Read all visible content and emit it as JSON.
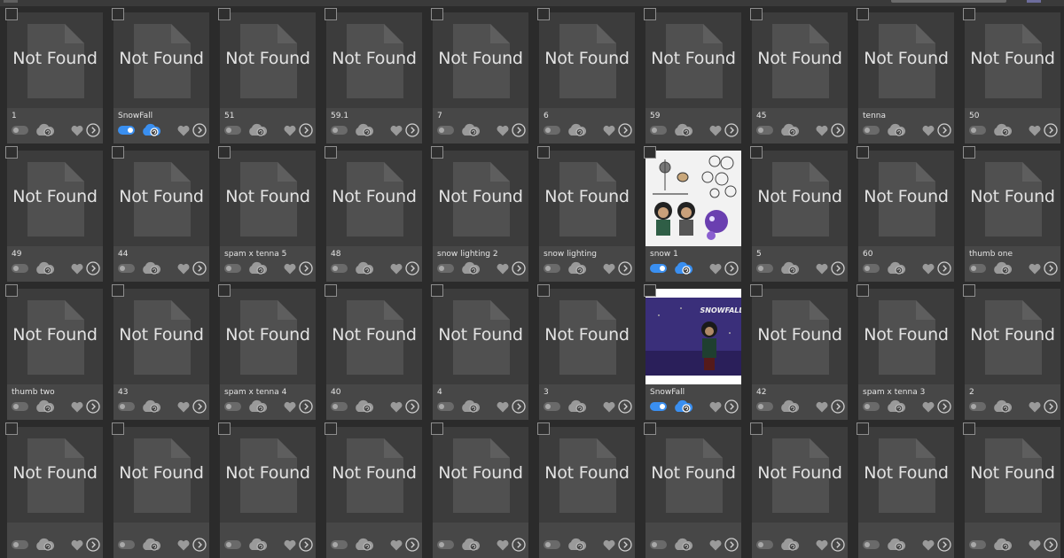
{
  "placeholder_text": "Not Found",
  "colors": {
    "toggle_on": "#3a8ff0",
    "cloud_on": "#3a8ff0",
    "icon_gray": "#9a9a9a"
  },
  "rows": [
    [
      {
        "name": "1",
        "status": "off",
        "thumb": "missing"
      },
      {
        "name": "SnowFall",
        "status": "on",
        "thumb": "missing"
      },
      {
        "name": "51",
        "status": "off",
        "thumb": "missing"
      },
      {
        "name": "59.1",
        "status": "off",
        "thumb": "missing"
      },
      {
        "name": "7",
        "status": "off",
        "thumb": "missing"
      },
      {
        "name": "6",
        "status": "off",
        "thumb": "missing"
      },
      {
        "name": "59",
        "status": "off",
        "thumb": "missing"
      },
      {
        "name": "45",
        "status": "off",
        "thumb": "missing"
      },
      {
        "name": "tenna",
        "status": "off",
        "thumb": "missing"
      },
      {
        "name": "50",
        "status": "off",
        "thumb": "missing"
      }
    ],
    [
      {
        "name": "49",
        "status": "off",
        "thumb": "missing"
      },
      {
        "name": "44",
        "status": "off",
        "thumb": "missing"
      },
      {
        "name": "spam x tenna 5",
        "status": "off",
        "thumb": "missing"
      },
      {
        "name": "48",
        "status": "off",
        "thumb": "missing"
      },
      {
        "name": "snow lighting 2",
        "status": "off",
        "thumb": "missing"
      },
      {
        "name": "snow lighting",
        "status": "off",
        "thumb": "missing"
      },
      {
        "name": "snow 1",
        "status": "on",
        "thumb": "character-sheet"
      },
      {
        "name": "5",
        "status": "off",
        "thumb": "missing"
      },
      {
        "name": "60",
        "status": "off",
        "thumb": "missing"
      },
      {
        "name": "thumb one",
        "status": "off",
        "thumb": "missing"
      }
    ],
    [
      {
        "name": "thumb two",
        "status": "off",
        "thumb": "missing"
      },
      {
        "name": "43",
        "status": "off",
        "thumb": "missing"
      },
      {
        "name": "spam x tenna 4",
        "status": "off",
        "thumb": "missing"
      },
      {
        "name": "40",
        "status": "off",
        "thumb": "missing"
      },
      {
        "name": "4",
        "status": "off",
        "thumb": "missing"
      },
      {
        "name": "3",
        "status": "off",
        "thumb": "missing"
      },
      {
        "name": "SnowFall",
        "status": "on",
        "thumb": "snowfall-cover",
        "thumb_title": "SNOWFALL"
      },
      {
        "name": "42",
        "status": "off",
        "thumb": "missing"
      },
      {
        "name": "spam x tenna 3",
        "status": "off",
        "thumb": "missing"
      },
      {
        "name": "2",
        "status": "off",
        "thumb": "missing"
      }
    ],
    [
      {
        "name": "",
        "status": "off",
        "thumb": "missing"
      },
      {
        "name": "",
        "status": "off",
        "thumb": "missing"
      },
      {
        "name": "",
        "status": "off",
        "thumb": "missing"
      },
      {
        "name": "",
        "status": "off",
        "thumb": "missing"
      },
      {
        "name": "",
        "status": "off",
        "thumb": "missing"
      },
      {
        "name": "",
        "status": "off",
        "thumb": "missing"
      },
      {
        "name": "",
        "status": "off",
        "thumb": "missing"
      },
      {
        "name": "",
        "status": "off",
        "thumb": "missing"
      },
      {
        "name": "",
        "status": "off",
        "thumb": "missing"
      },
      {
        "name": "",
        "status": "off",
        "thumb": "missing"
      }
    ]
  ]
}
